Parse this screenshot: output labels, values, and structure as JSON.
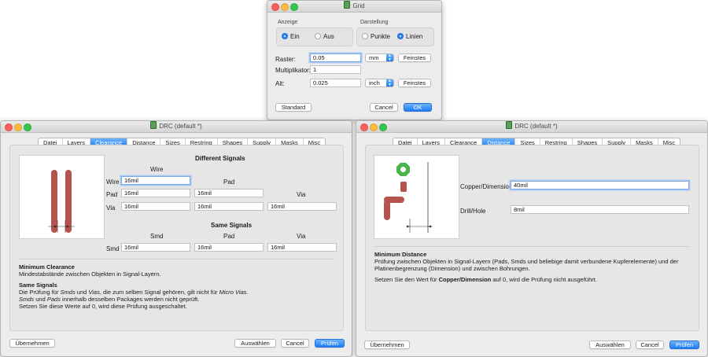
{
  "grid": {
    "title": "Grid",
    "anzeige_label": "Anzeige",
    "anzeige_on": "Ein",
    "anzeige_off": "Aus",
    "darstellung_label": "Darstellung",
    "darstellung_dots": "Punkte",
    "darstellung_lines": "Linien",
    "raster_label": "Raster:",
    "raster_value": "0.05",
    "raster_unit": "mm",
    "raster_finest": "Feinstes",
    "mult_label": "Multiplikator:",
    "mult_value": "1",
    "alt_label": "Alt:",
    "alt_value": "0.025",
    "alt_unit": "inch",
    "alt_finest": "Feinstes",
    "standard_button": "Standard",
    "cancel_button": "Cancel",
    "ok_button": "OK"
  },
  "drc_left": {
    "title": "DRC (default *)",
    "tabs": [
      "Datei",
      "Layers",
      "Clearance",
      "Distance",
      "Sizes",
      "Restring",
      "Shapes",
      "Supply",
      "Masks",
      "Misc"
    ],
    "active_tab": "Clearance",
    "different_signals": "Different Signals",
    "col_wire": "Wire",
    "col_pad": "Pad",
    "col_via": "Via",
    "row_wire": "Wire",
    "row_pad": "Pad",
    "row_via": "Via",
    "wire_wire": "16mil",
    "pad_wire": "16mil",
    "pad_pad": "16mil",
    "via_wire": "16mil",
    "via_pad": "16mil",
    "via_via": "16mil",
    "same_signals": "Same Signals",
    "same_col_smd": "Smd",
    "same_col_pad": "Pad",
    "same_col_via": "Via",
    "same_row_smd": "Smd",
    "smd_smd": "16mil",
    "smd_pad": "16mil",
    "smd_via": "16mil",
    "help_title": "Minimum Clearance",
    "help_line1": "Mindestabstände zwischen Objekten in Signal-Layern.",
    "help_subtitle": "Same Signals",
    "help_p1": "Die Prüfung für Smds und Vias, die zum selben Signal gehören, gilt nicht für Micro Vias.",
    "help_p2": "Smds und Pads innerhalb desselben Packages werden nicht geprüft.",
    "help_p3": "Setzen Sie diese Werte auf 0, wird diese Prüfung ausgeschaltet.",
    "btn_import": "Übernehmen",
    "btn_select": "Auswählen",
    "btn_cancel": "Cancel",
    "btn_check": "Prüfen"
  },
  "drc_right": {
    "title": "DRC (default *)",
    "tabs": [
      "Datei",
      "Layers",
      "Clearance",
      "Distance",
      "Sizes",
      "Restring",
      "Shapes",
      "Supply",
      "Masks",
      "Misc"
    ],
    "active_tab": "Distance",
    "copper_label": "Copper/Dimension",
    "copper_value": "40mil",
    "drill_label": "Drill/Hole",
    "drill_value": "8mil",
    "help_title": "Minimum Distance",
    "help_line1": "Prüfung zwischen Objekten in Signal-Layern (Pads, Smds und beliebige damit verbundene Kupferelemente) und der",
    "help_line2": "Platinenbegrenzung (Dimension) und zwischen Bohrungen.",
    "help_line3a": "Setzen Sie den Wert für ",
    "help_line3b": "Copper/Dimension",
    "help_line3c": " auf 0, wird die Prüfung nicht ausgeführt.",
    "btn_import": "Übernehmen",
    "btn_select": "Auswählen",
    "btn_cancel": "Cancel",
    "btn_check": "Prüfen"
  },
  "colors": {
    "accent": "#1d7df5",
    "trace": "#b5534c",
    "pad_green": "#4bb34b"
  }
}
